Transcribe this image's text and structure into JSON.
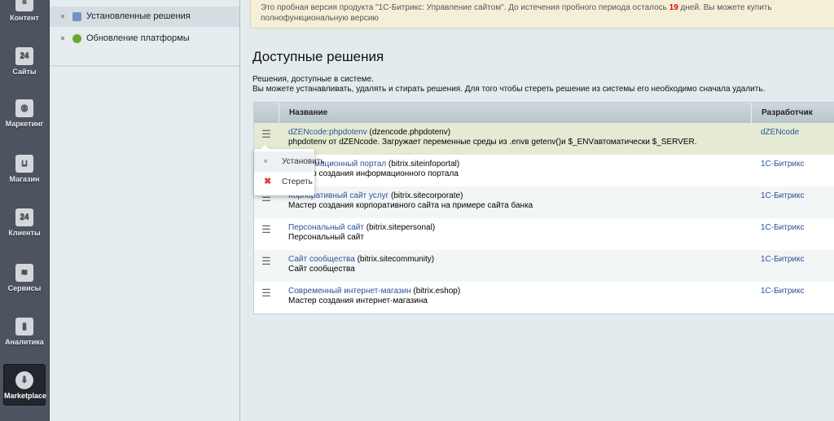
{
  "sidebar": {
    "items": [
      {
        "label": "Контент",
        "icon": "content-icon",
        "glyph": "≡"
      },
      {
        "label": "Сайты",
        "icon": "calendar-24-icon",
        "glyph": "24"
      },
      {
        "label": "Маркетинг",
        "icon": "target-icon",
        "glyph": "◎"
      },
      {
        "label": "Магазин",
        "icon": "basket-icon",
        "glyph": "⊔"
      },
      {
        "label": "Клиенты",
        "icon": "clients-24-icon",
        "glyph": "24"
      },
      {
        "label": "Сервисы",
        "icon": "layers-icon",
        "glyph": "≋"
      },
      {
        "label": "Аналитика",
        "icon": "chart-icon",
        "glyph": "▮"
      },
      {
        "label": "Marketplace",
        "icon": "cloud-download-icon",
        "glyph": "⬇"
      }
    ]
  },
  "subnav": {
    "items": [
      {
        "label": "Установленные решения"
      },
      {
        "label": "Обновление платформы"
      }
    ]
  },
  "notice": {
    "before": "Это пробная версия продукта \"1С-Битрикс: Управление сайтом\". До истечения пробного периода осталось ",
    "days": "19",
    "after": " дней. Вы можете купить полнофункциональную версию"
  },
  "page": {
    "title": "Доступные решения",
    "desc1": "Решения, доступные в системе.",
    "desc2": "Вы можете устанавливать, удалять и стирать решения. Для того чтобы стереть решение из системы его необходимо сначала удалить."
  },
  "table": {
    "headers": [
      "Название",
      "Разработчик"
    ],
    "rows": [
      {
        "name": "dZENcode:phpdotenv",
        "code": " (dzencode.phpdotenv)",
        "desc": "phpdotenv от dZENcode. Загружает переменные среды из .envв getenv()и $_ENVавтоматически $_SERVER.",
        "dev": "dZENcode"
      },
      {
        "name": "Информационный портал",
        "code": " (bitrix.siteinfoportal)",
        "desc": "Мастер создания информационного портала",
        "dev": "1С-Битрикс"
      },
      {
        "name": "Корпоративный сайт услуг",
        "code": " (bitrix.sitecorporate)",
        "desc": "Мастер создания корпоративного сайта на примере сайта банка",
        "dev": "1С-Битрикс"
      },
      {
        "name": "Персональный сайт",
        "code": " (bitrix.sitepersonal)",
        "desc": "Персональный сайт",
        "dev": "1С-Битрикс"
      },
      {
        "name": "Сайт сообщества",
        "code": " (bitrix.sitecommunity)",
        "desc": "Сайт сообщества",
        "dev": "1С-Битрикс"
      },
      {
        "name": "Современный интернет-магазин",
        "code": " (bitrix.eshop)",
        "desc": "Мастер создания интернет-магазина",
        "dev": "1С-Битрикс"
      }
    ]
  },
  "menu": {
    "items": [
      {
        "label": "Установить"
      },
      {
        "label": "Стереть"
      }
    ]
  }
}
